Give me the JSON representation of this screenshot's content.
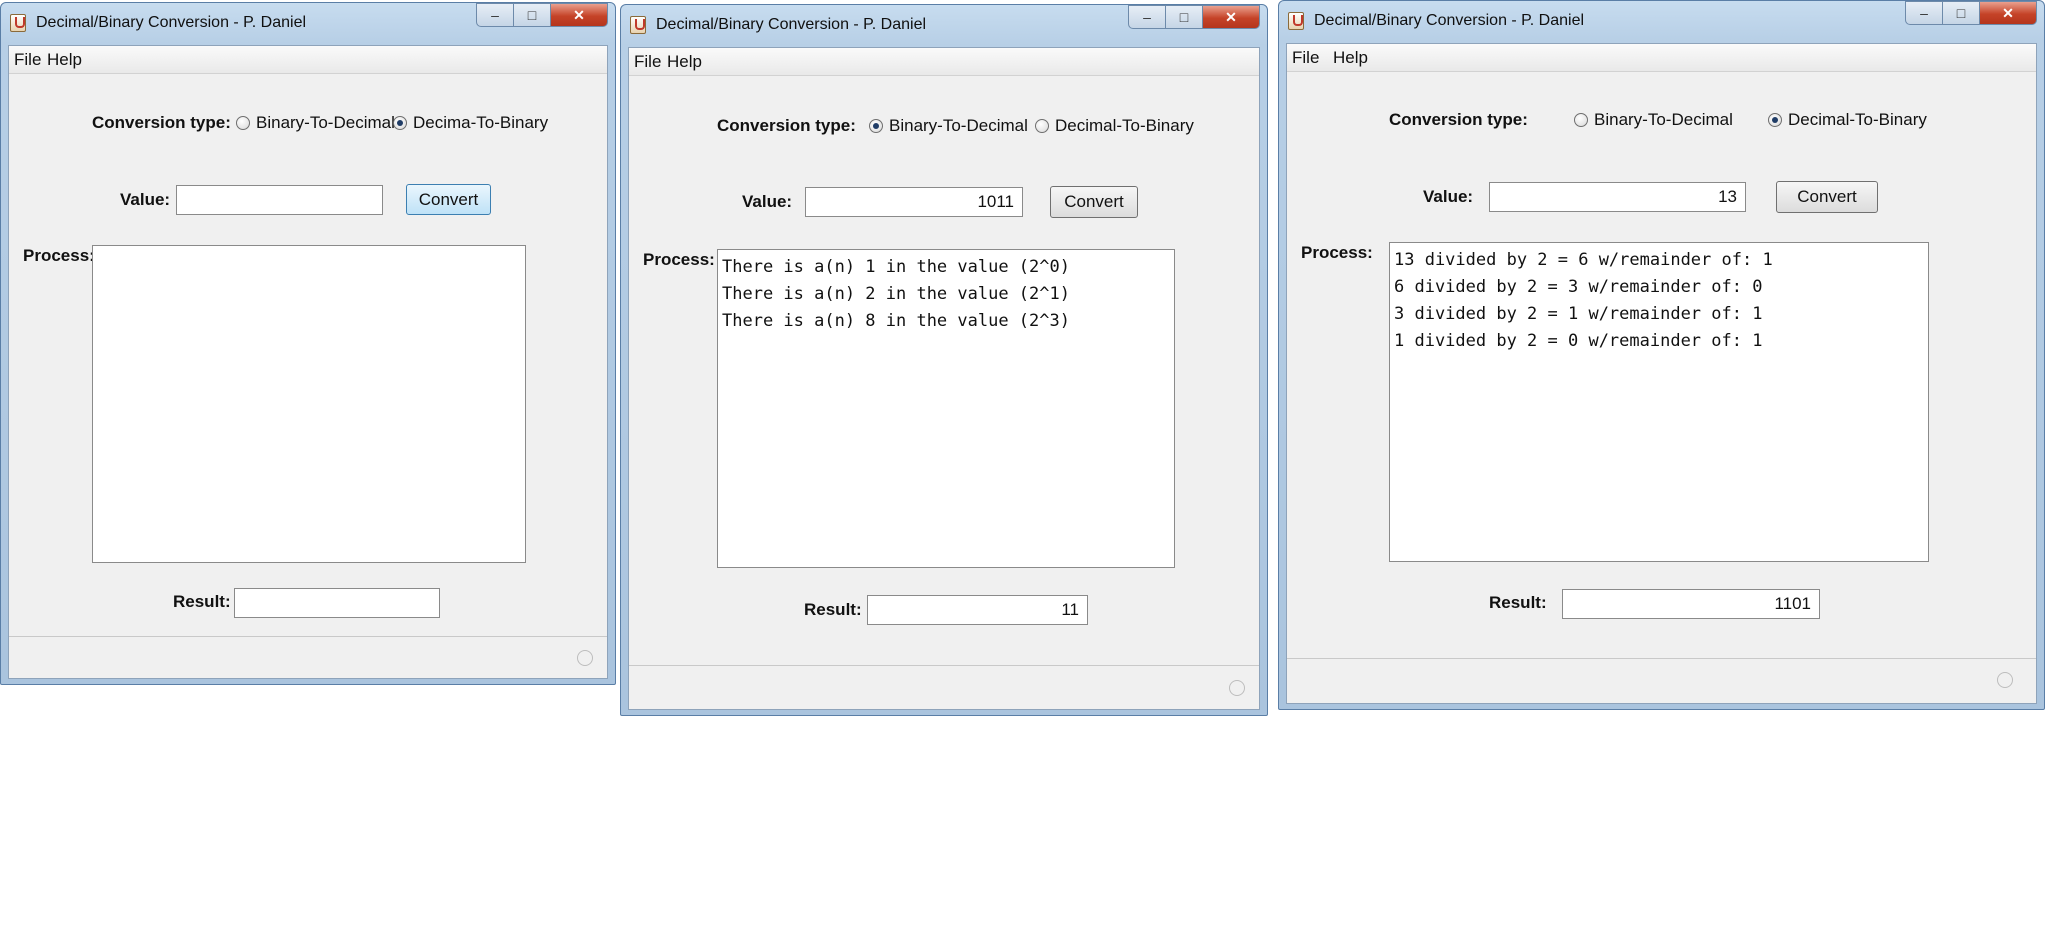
{
  "windows": [
    {
      "title": "Decimal/Binary Conversion - P. Daniel",
      "menu": [
        "File",
        "Help"
      ],
      "conversion_label": "Conversion type:",
      "radio_b2d": "Binary-To-Decimal",
      "radio_d2b": "Decima-To-Binary",
      "selected": "decimal-to-binary",
      "value_label": "Value:",
      "value": "",
      "convert_label": "Convert",
      "process_label": "Process:",
      "process_lines": [],
      "result_label": "Result:",
      "result": ""
    },
    {
      "title": "Decimal/Binary Conversion - P. Daniel",
      "menu": [
        "File",
        "Help"
      ],
      "conversion_label": "Conversion type:",
      "radio_b2d": "Binary-To-Decimal",
      "radio_d2b": "Decimal-To-Binary",
      "selected": "binary-to-decimal",
      "value_label": "Value:",
      "value": "1011",
      "convert_label": "Convert",
      "process_label": "Process:",
      "process_lines": [
        "There is a(n) 1 in the value (2^0)",
        "There is a(n) 2 in the value (2^1)",
        "There is a(n) 8 in the value (2^3)"
      ],
      "result_label": "Result:",
      "result": "11"
    },
    {
      "title": "Decimal/Binary Conversion - P. Daniel",
      "menu": [
        "File",
        "Help"
      ],
      "conversion_label": "Conversion type:",
      "radio_b2d": "Binary-To-Decimal",
      "radio_d2b": "Decimal-To-Binary",
      "selected": "decimal-to-binary",
      "value_label": "Value:",
      "value": "13",
      "convert_label": "Convert",
      "process_label": "Process:",
      "process_lines": [
        "13 divided by 2 = 6 w/remainder of: 1",
        "6 divided by 2 = 3 w/remainder of: 0",
        "3 divided by 2 = 1 w/remainder of: 1",
        "1 divided by 2 = 0 w/remainder of: 1"
      ],
      "result_label": "Result:",
      "result": "1101"
    }
  ],
  "colors": {
    "frame": "#b7cfe6",
    "panel": "#f0f0f0",
    "close": "#c54328"
  }
}
